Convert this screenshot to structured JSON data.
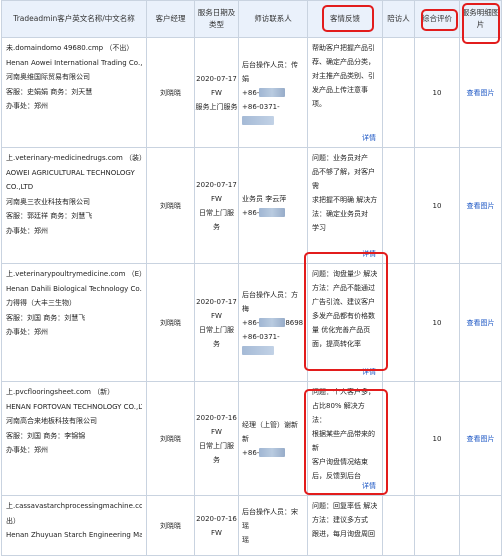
{
  "columns": {
    "company": "Tradeadmin客户英文名称/中文名称",
    "sales": "客户经理",
    "service": "服务日期及类型",
    "contact": "师访联系人",
    "feedback": "客情反馈",
    "visitor": "陪访人",
    "score": "综合评价",
    "report": "服务明细图片"
  },
  "rows": [
    {
      "company_lines": [
        "未.domaindomo 49680.cmp （不出）",
        "Henan Aowei International Trading Co., Ltd",
        "河南奥维国际贸易有限公司",
        "客服：史娟娟  商务：刘天慧",
        "办事处：郑州"
      ],
      "sales": "刘晓晓",
      "service_lines": [
        "2020-07-17",
        "FW",
        "服务上门服务"
      ],
      "contact_lines": [
        "后台操作人员：传娟",
        "+86-",
        "+86-0371-"
      ],
      "contact_tail": [
        "367",
        ""
      ],
      "feedback_lines": [
        "帮助客户把握产品引",
        "荐、确定产品分类，",
        "对主推产品类别、引",
        "发产品上传注意事",
        "项。"
      ],
      "detail": "详情",
      "score": "10",
      "report": "查看图片"
    },
    {
      "company_lines": [
        "上.veterinary-medicinedrugs.com （装）",
        "AOWEI AGRICULTURAL TECHNOLOGY",
        "CO.,LTD",
        "河南奥三农业科技有限公司",
        "客服：郭廷祥  商务：刘慧飞",
        "办事处：郑州"
      ],
      "sales": "刘晓晓",
      "service_lines": [
        "2020-07-17",
        "FW",
        "日常上门服",
        "务"
      ],
      "contact_lines": [
        "业务员  李云萍",
        "+86-"
      ],
      "contact_tail": [
        "6"
      ],
      "feedback_lines": [
        "问题：业务员对产",
        "品不够了解，对客户需",
        "求把握不明确  解决方",
        "法：确定业务员对",
        "学习"
      ],
      "detail": "详情",
      "score": "10",
      "report": "查看图片"
    },
    {
      "company_lines": [
        "上.veterinarypoultrymedicine.com （E）",
        "Henan Dahili Biological Technology Co.,LTD",
        "力得得（大丰三生物）",
        "客服：刘国  商务：刘慧飞",
        "办事处：郑州"
      ],
      "sales": "刘晓晓",
      "service_lines": [
        "2020-07-17",
        "FW",
        "日常上门服",
        "务"
      ],
      "contact_lines": [
        "后台操作人员：方",
        "梅",
        "+86-",
        "+86-0371-"
      ],
      "contact_tail": [
        "",
        "",
        "8698",
        ""
      ],
      "feedback_lines": [
        "问题：询盘量少  解决",
        "方法：产品不能通过",
        "广告引流、建议客户",
        "多发产品都有价格数",
        "量  优化完善产品页",
        "面，提高转化率"
      ],
      "detail": "详情",
      "score": "10",
      "report": "查看图片"
    },
    {
      "company_lines": [
        "上.pvcflooringsheet.com （新）",
        "HENAN FORTOVAN TECHNOLOGY CO.,LTD",
        "河南高合来地板科技有限公司",
        "客服：刘国  商务：李锦锦",
        "办事处：郑州"
      ],
      "sales": "刘晓晓",
      "service_lines": [
        "2020-07-16",
        "FW",
        "日常上门服",
        "务"
      ],
      "contact_lines": [
        "经理（上管）谢新新",
        "+86-"
      ],
      "contact_tail": [
        "5"
      ],
      "feedback_lines": [
        "问题：个人客户多，",
        "占比80%  解决方法：",
        "根据某些产品带来的新",
        "客户询盘情况结束",
        "后，反馈到后台"
      ],
      "detail": "详情",
      "score": "10",
      "report": "查看图片"
    },
    {
      "company_lines": [
        "上.cassavastarchprocessingmachine.com （金",
        "出）",
        "Henan Zhuyuan Starch Engineering Machinery"
      ],
      "sales": "刘晓晓",
      "service_lines": [
        "2020-07-16",
        "FW"
      ],
      "contact_lines": [
        "后台操作人员：宋瑶",
        "瑶"
      ],
      "contact_tail": [],
      "feedback_lines": [
        "问题：回复率低  解决",
        "方法：建议多方式",
        "跟进，每月询盘周回"
      ],
      "detail": "",
      "score": "",
      "report": ""
    }
  ]
}
